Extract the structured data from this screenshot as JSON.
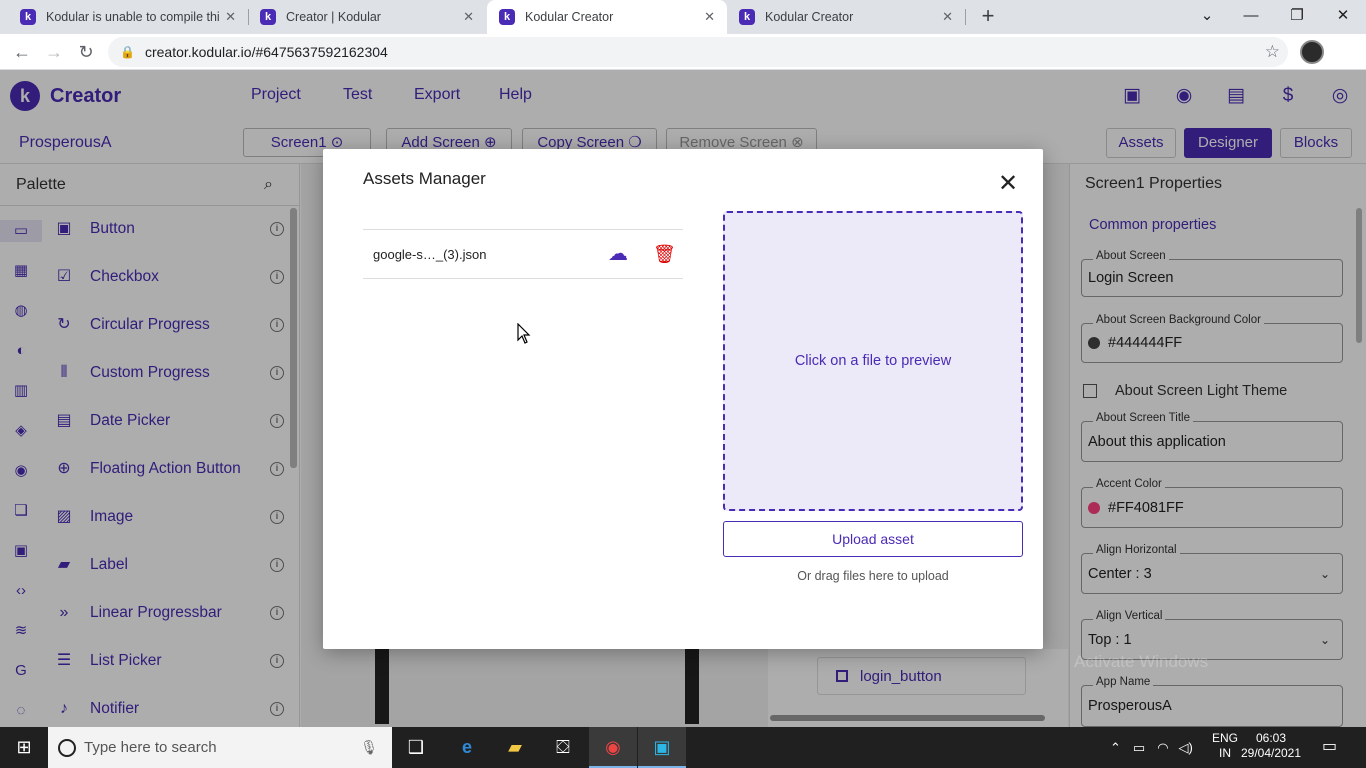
{
  "browser": {
    "tabs": [
      {
        "title": "Kodular is unable to compile this",
        "close": "✕"
      },
      {
        "title": "Creator | Kodular",
        "close": "✕"
      },
      {
        "title": "Kodular Creator",
        "close": "✕"
      },
      {
        "title": "Kodular Creator",
        "close": "✕"
      }
    ],
    "url": "creator.kodular.io/#6475637592162304"
  },
  "app": {
    "brand": "Creator",
    "logo_letter": "k",
    "menu": [
      "Project",
      "Test",
      "Export",
      "Help"
    ],
    "project_name": "ProsperousA",
    "screen_select": "Screen1",
    "add_screen": "Add Screen",
    "copy_screen": "Copy Screen",
    "remove_screen": "Remove Screen",
    "mode_assets": "Assets",
    "mode_designer": "Designer",
    "mode_blocks": "Blocks"
  },
  "palette": {
    "title": "Palette",
    "items": [
      {
        "label": "Button",
        "icon": "button-icon"
      },
      {
        "label": "Checkbox",
        "icon": "checkbox-icon"
      },
      {
        "label": "Circular Progress",
        "icon": "circular-progress-icon"
      },
      {
        "label": "Custom Progress",
        "icon": "custom-progress-icon"
      },
      {
        "label": "Date Picker",
        "icon": "calendar-icon"
      },
      {
        "label": "Floating Action Button",
        "icon": "plus-circle-icon"
      },
      {
        "label": "Image",
        "icon": "image-icon"
      },
      {
        "label": "Label",
        "icon": "label-icon"
      },
      {
        "label": "Linear Progressbar",
        "icon": "fast-forward-icon"
      },
      {
        "label": "List Picker",
        "icon": "list-icon"
      },
      {
        "label": "Notifier",
        "icon": "bell-icon"
      }
    ]
  },
  "properties": {
    "title": "Screen1 Properties",
    "section": "Common properties",
    "about_screen_label": "About Screen",
    "about_screen_value": "Login Screen",
    "bg_color_label": "About Screen Background Color",
    "bg_color_value": "#444444FF",
    "bg_color": "#444444",
    "light_theme_label": "About Screen Light Theme",
    "screen_title_label": "About Screen Title",
    "screen_title_value": "About this application",
    "accent_label": "Accent Color",
    "accent_value": "#FF4081FF",
    "accent_color": "#FF4081",
    "align_h_label": "Align Horizontal",
    "align_h_value": "Center : 3",
    "align_v_label": "Align Vertical",
    "align_v_value": "Top : 1",
    "app_name_label": "App Name",
    "app_name_value": "ProsperousA"
  },
  "component_tree": {
    "item": "login_button"
  },
  "dialog": {
    "title": "Assets Manager",
    "asset_file": "google-s…_(3).json",
    "preview_text": "Click on a file to preview",
    "upload_label": "Upload asset",
    "drag_hint": "Or drag files here to upload"
  },
  "watermark": "Activate Windows",
  "taskbar": {
    "search_placeholder": "Type here to search",
    "lang_line1": "ENG",
    "lang_line2": "IN",
    "time": "06:03",
    "date": "29/04/2021"
  },
  "colors": {
    "brand": "#4a2bb5",
    "delete": "#dd0000"
  }
}
